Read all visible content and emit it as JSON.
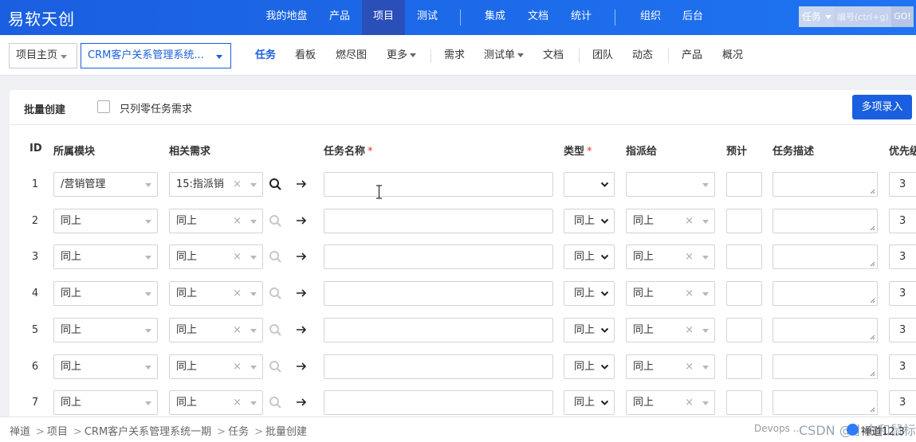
{
  "app": {
    "brand": "易软天创"
  },
  "topnav": {
    "items": [
      "我的地盘",
      "产品",
      "项目",
      "测试",
      "集成",
      "文档",
      "统计",
      "组织",
      "后台"
    ],
    "active": "项目",
    "search_type": "任务",
    "search_placeholder": "编号(ctrl+g)",
    "search_go": "GO!"
  },
  "subnav": {
    "home_label": "项目主页",
    "project_label": "CRM客户关系管理系统...",
    "items": [
      "任务",
      "看板",
      "燃尽图",
      "更多",
      "需求",
      "测试单",
      "文档",
      "团队",
      "动态",
      "产品",
      "概况"
    ],
    "active": "任务"
  },
  "page": {
    "title": "批量创建",
    "only_zero_task_label": "只列零任务需求",
    "multi_entry_button": "多项录入"
  },
  "table": {
    "headers": {
      "id": "ID",
      "module": "所属模块",
      "story": "相关需求",
      "name": "任务名称",
      "type": "类型",
      "assigned": "指派给",
      "estimate": "预计",
      "desc": "任务描述",
      "priority": "优先级"
    },
    "rows": [
      {
        "id": "1",
        "module": "/营销管理",
        "story": "15:指派销",
        "type": "",
        "assigned": "",
        "priority": "3"
      },
      {
        "id": "2",
        "module": "同上",
        "story": "同上",
        "type": "同上",
        "assigned": "同上",
        "priority": "3"
      },
      {
        "id": "3",
        "module": "同上",
        "story": "同上",
        "type": "同上",
        "assigned": "同上",
        "priority": "3"
      },
      {
        "id": "4",
        "module": "同上",
        "story": "同上",
        "type": "同上",
        "assigned": "同上",
        "priority": "3"
      },
      {
        "id": "5",
        "module": "同上",
        "story": "同上",
        "type": "同上",
        "assigned": "同上",
        "priority": "3"
      },
      {
        "id": "6",
        "module": "同上",
        "story": "同上",
        "type": "同上",
        "assigned": "同上",
        "priority": "3"
      },
      {
        "id": "7",
        "module": "同上",
        "story": "同上",
        "type": "同上",
        "assigned": "同上",
        "priority": "3"
      }
    ]
  },
  "footer": {
    "breadcrumb": [
      "禅道",
      "项目",
      "CRM客户关系管理系统一期",
      "任务",
      "批量创建"
    ],
    "brand_text": "Devops ...",
    "watermark": "CSDN @小虫和鼠标",
    "version": "禅道12.3"
  },
  "colors": {
    "primary": "#1a5fdf",
    "active_nav": "#2b4fb8",
    "required": "#e3342f"
  }
}
